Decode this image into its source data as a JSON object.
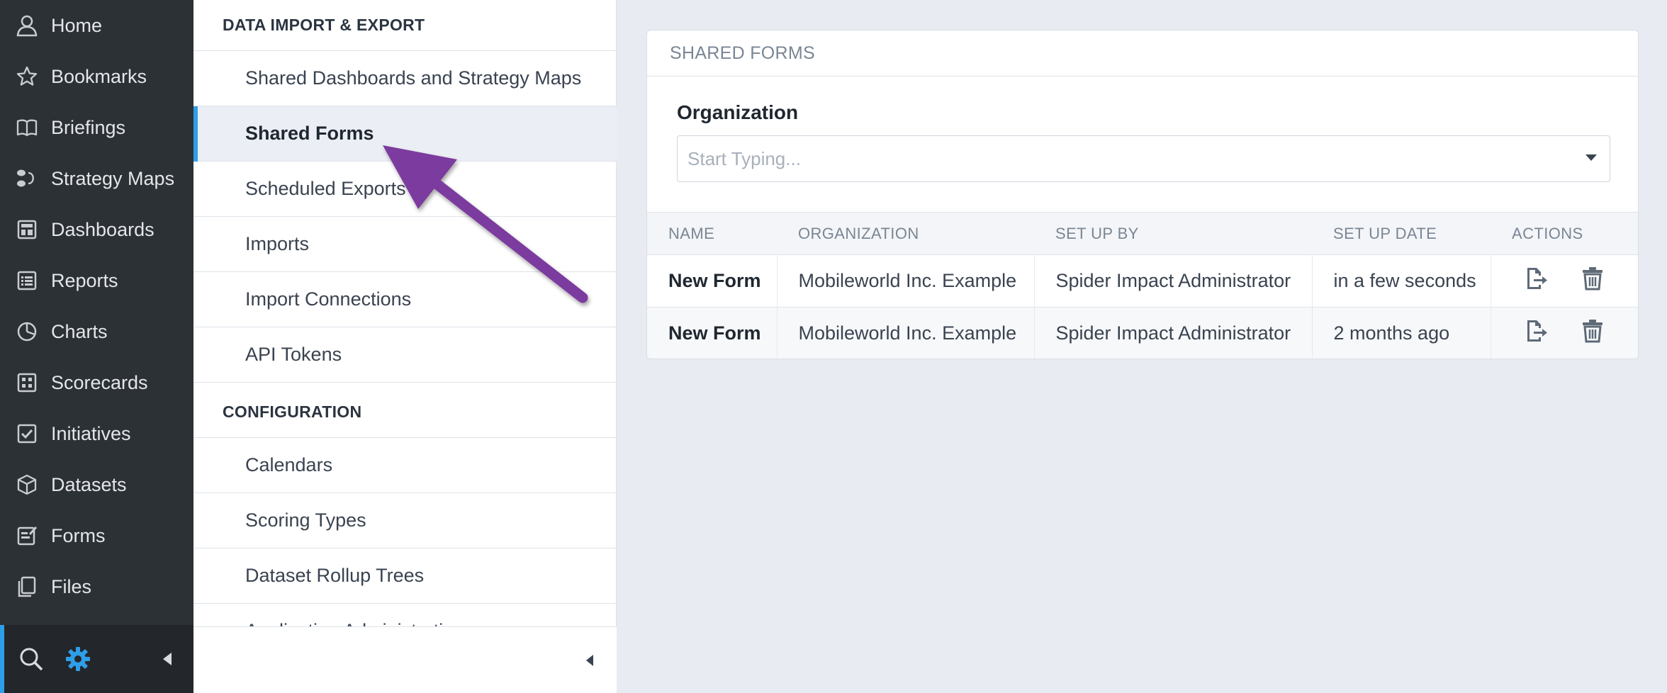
{
  "nav": {
    "items": [
      {
        "label": "Home",
        "icon": "user-icon"
      },
      {
        "label": "Bookmarks",
        "icon": "star-icon"
      },
      {
        "label": "Briefings",
        "icon": "book-icon"
      },
      {
        "label": "Strategy Maps",
        "icon": "strategy-map-icon"
      },
      {
        "label": "Dashboards",
        "icon": "dashboard-icon"
      },
      {
        "label": "Reports",
        "icon": "report-icon"
      },
      {
        "label": "Charts",
        "icon": "pie-chart-icon"
      },
      {
        "label": "Scorecards",
        "icon": "scorecard-icon"
      },
      {
        "label": "Initiatives",
        "icon": "checkbox-icon"
      },
      {
        "label": "Datasets",
        "icon": "cube-icon"
      },
      {
        "label": "Forms",
        "icon": "form-icon"
      },
      {
        "label": "Files",
        "icon": "files-icon"
      }
    ],
    "accent_color": "#2f9ee8"
  },
  "menu": {
    "section1_title": "DATA IMPORT & EXPORT",
    "section1_items": [
      "Shared Dashboards and Strategy Maps",
      "Shared Forms",
      "Scheduled Exports",
      "Imports",
      "Import Connections",
      "API Tokens"
    ],
    "active_item": "Shared Forms",
    "section2_title": "CONFIGURATION",
    "section2_items": [
      "Calendars",
      "Scoring Types",
      "Dataset Rollup Trees",
      "Application Administration"
    ]
  },
  "card": {
    "title": "SHARED FORMS",
    "org_label": "Organization",
    "org_placeholder": "Start Typing...",
    "columns": [
      "NAME",
      "ORGANIZATION",
      "SET UP BY",
      "SET UP DATE",
      "ACTIONS"
    ],
    "rows": [
      {
        "name": "New Form",
        "organization": "Mobileworld Inc. Example",
        "setup_by": "Spider Impact Administrator",
        "setup_date": "in a few seconds"
      },
      {
        "name": "New Form",
        "organization": "Mobileworld Inc. Example",
        "setup_by": "Spider Impact Administrator",
        "setup_date": "2 months ago"
      }
    ]
  },
  "annotation_color": "#7b3a9e"
}
